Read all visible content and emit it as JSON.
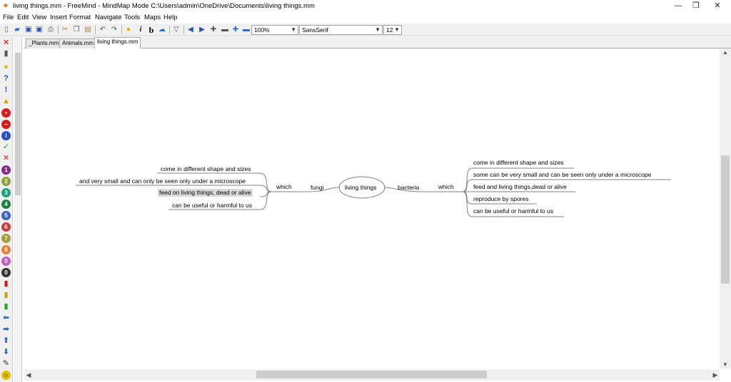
{
  "window": {
    "title": "living things.mm - FreeMind - MindMap Mode C:\\Users\\admin\\OneDrive\\Documents\\living things.mm",
    "app_icon": "butterfly-icon",
    "minimize": "—",
    "restore": "❐",
    "close": "✕"
  },
  "menu": [
    "File",
    "Edit",
    "View",
    "Insert",
    "Format",
    "Navigate",
    "Tools",
    "Maps",
    "Help"
  ],
  "toolbar": {
    "zoom": "100%",
    "font": "SansSerif",
    "font_size": "12",
    "bold": "b",
    "italic": "i"
  },
  "tabs": [
    "_Plants.mm",
    "Animals.mm",
    "living things.mm"
  ],
  "mindmap": {
    "root": "living things",
    "left": {
      "branch": "fungi",
      "connector": "which",
      "children": [
        "come in different shape and sizes",
        "and very small and can only be seen only under a microscope",
        "feed on living things, dead or alive",
        "can be useful or harmful to us"
      ]
    },
    "right": {
      "branch": "bacteria",
      "connector": "which",
      "children": [
        "come in different shape and sizes",
        "some can be very small and can be seen only under a microscope",
        "feed and living things,dead or alive",
        "reproduce by spores",
        "can be useful or harmful to us"
      ]
    }
  },
  "colors": {
    "edge": "#808080",
    "selected_bg": "#d9d9d9"
  }
}
